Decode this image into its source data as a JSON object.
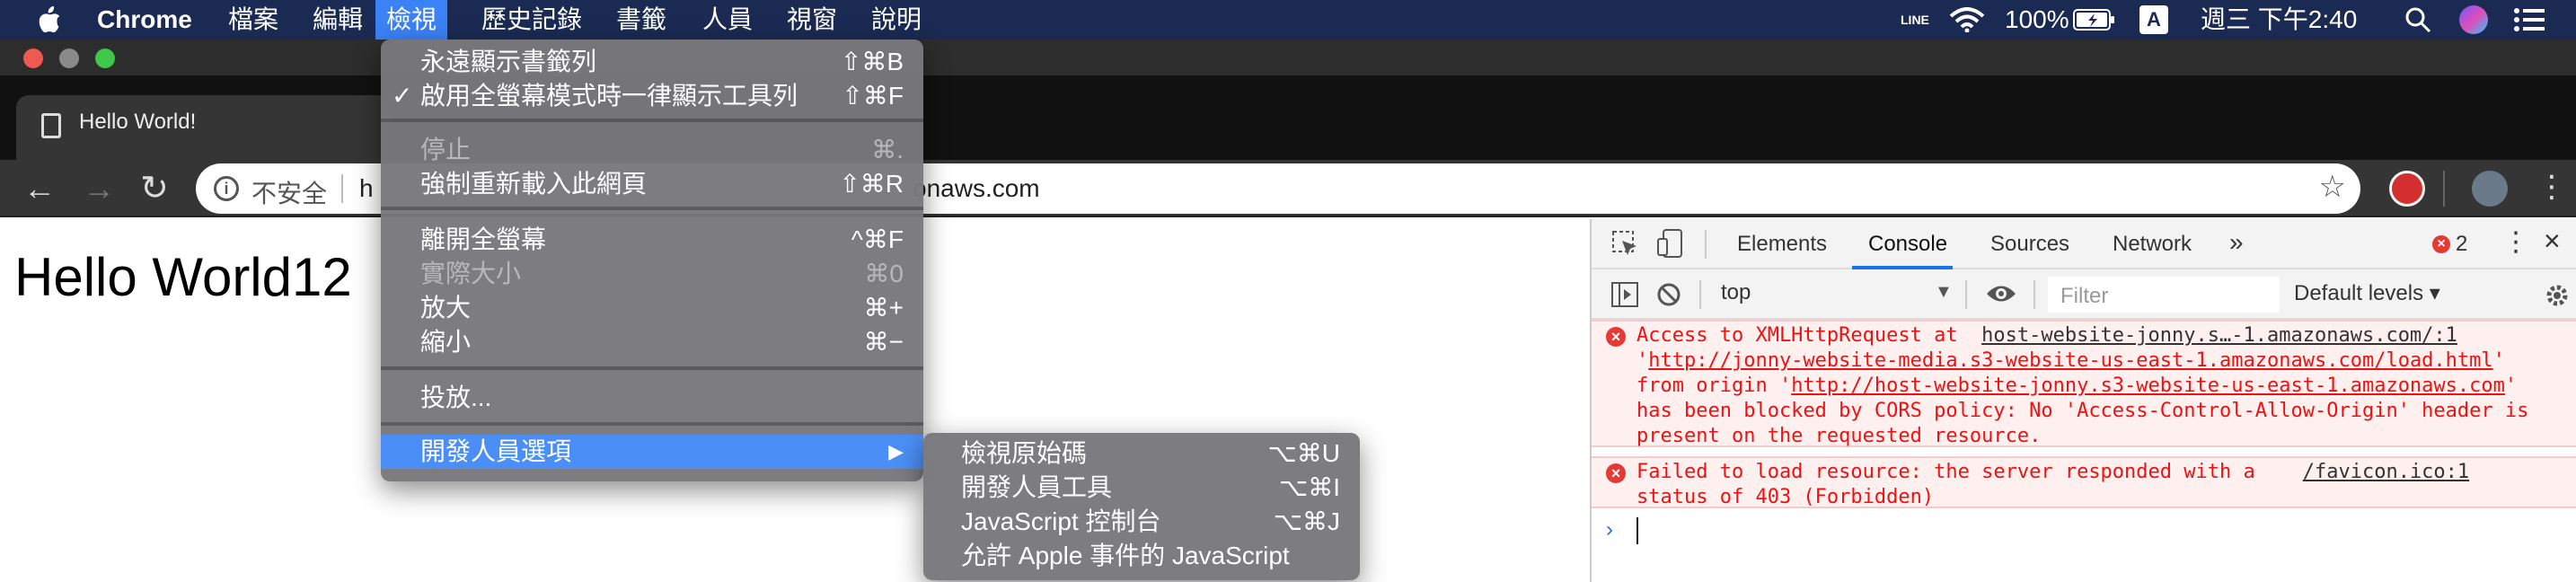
{
  "menubar": {
    "app": "Chrome",
    "items": [
      "檔案",
      "編輯",
      "檢視",
      "歷史記錄",
      "書籤",
      "人員",
      "視窗",
      "說明"
    ],
    "status": {
      "line": "LINE",
      "battery": "100%",
      "input": "A",
      "clock": "週三 下午2:40"
    }
  },
  "tab": {
    "title": "Hello World!"
  },
  "omnibox": {
    "insecure_label": "不安全",
    "url_start": "h",
    "url_end": "onaws.com"
  },
  "page": {
    "heading": "Hello World12"
  },
  "view_menu": {
    "items": [
      {
        "label": "永遠顯示書籤列",
        "shortcut": "⇧⌘B"
      },
      {
        "label": "啟用全螢幕模式時一律顯示工具列",
        "shortcut": "⇧⌘F",
        "check": "✓"
      },
      {
        "label": "停止",
        "shortcut": "⌘."
      },
      {
        "label": "強制重新載入此網頁",
        "shortcut": "⇧⌘R"
      },
      {
        "label": "離開全螢幕",
        "shortcut": "^⌘F"
      },
      {
        "label": "實際大小",
        "shortcut": "⌘0"
      },
      {
        "label": "放大",
        "shortcut": "⌘+"
      },
      {
        "label": "縮小",
        "shortcut": "⌘−"
      },
      {
        "label": "投放..."
      },
      {
        "label": "開發人員選項",
        "arrow": "▶"
      }
    ]
  },
  "dev_submenu": {
    "items": [
      {
        "label": "檢視原始碼",
        "shortcut": "⌥⌘U"
      },
      {
        "label": "開發人員工具",
        "shortcut": "⌥⌘I"
      },
      {
        "label": "JavaScript 控制台",
        "shortcut": "⌥⌘J"
      },
      {
        "label": "允許 Apple 事件的 JavaScript"
      }
    ]
  },
  "devtools": {
    "tabs": [
      "Elements",
      "Console",
      "Sources",
      "Network",
      "»"
    ],
    "error_count": "2",
    "context": "top",
    "filter_placeholder": "Filter",
    "levels": "Default levels ▾",
    "errors": [
      {
        "text_a": "Access to XMLHttpRequest at  ",
        "link_a": "host-website-jonny.s…-1.amazonaws.com/:1",
        "text_b": "'",
        "link_b": "http://jonny-website-media.s3-website-us-east-1.amazonaws.com/load.html",
        "text_c": "' from origin '",
        "link_c": "http://host-website-jonny.s3-website-us-east-1.amazonaws.com",
        "text_d": "' has been blocked by CORS policy: No 'Access-Control-Allow-Origin' header is present on the requested resource."
      },
      {
        "text_a": "Failed to load resource: the server responded with a    ",
        "link_a": "/favicon.ico:1",
        "text_b": "status of 403 (Forbidden)"
      }
    ]
  }
}
